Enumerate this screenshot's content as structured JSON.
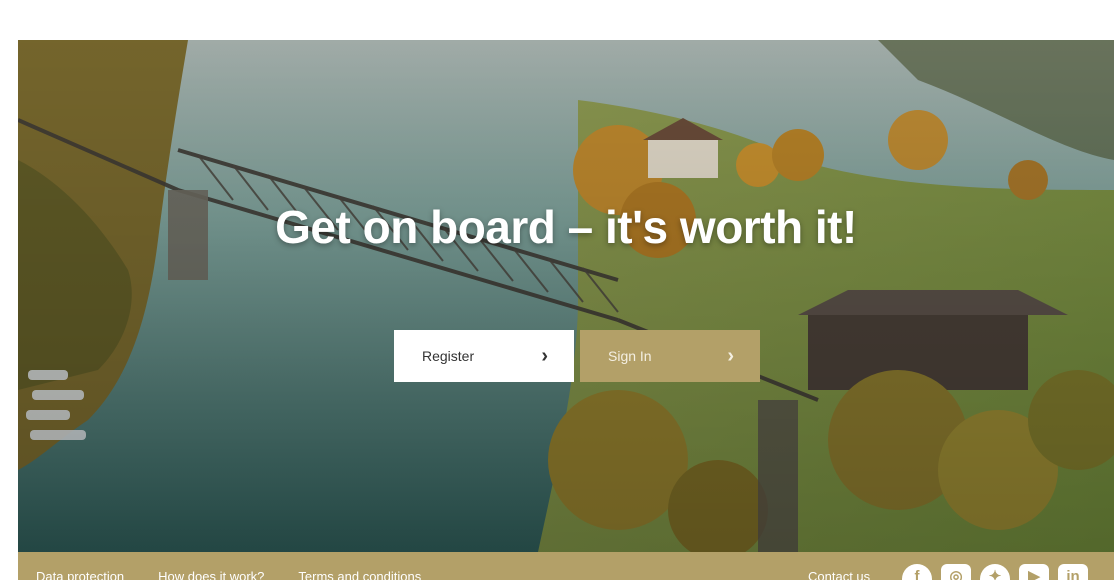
{
  "hero": {
    "headline": "Get on board – it's worth it!"
  },
  "cta": {
    "register_label": "Register",
    "signin_label": "Sign In",
    "chevron": "›"
  },
  "footer": {
    "links": [
      "Data protection",
      "How does it work?",
      "Terms and conditions"
    ],
    "contact_label": "Contact us",
    "socials": [
      {
        "name": "facebook-icon",
        "glyph": "f"
      },
      {
        "name": "instagram-icon",
        "glyph": "◎"
      },
      {
        "name": "twitter-icon",
        "glyph": "✦"
      },
      {
        "name": "youtube-icon",
        "glyph": "▶"
      },
      {
        "name": "linkedin-icon",
        "glyph": "in"
      }
    ]
  },
  "colors": {
    "accent": "#b3a068",
    "headline": "#ffffff",
    "button_light": "#ffffff"
  }
}
